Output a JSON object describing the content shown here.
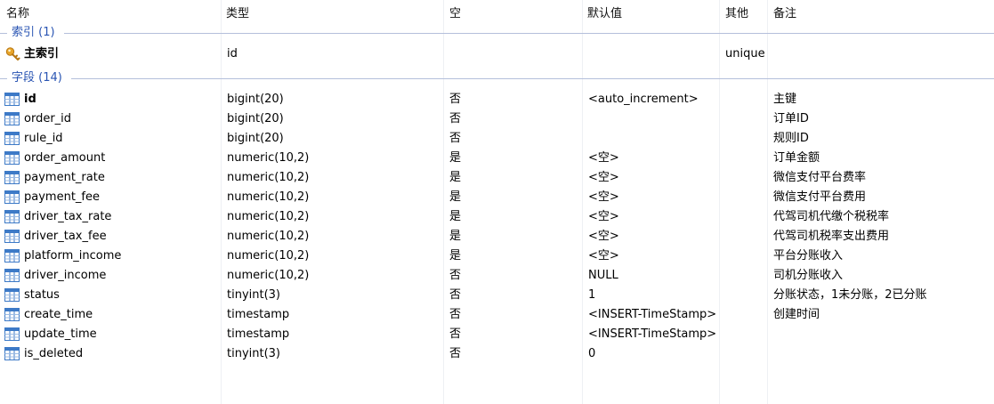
{
  "columns": {
    "name": "名称",
    "type": "类型",
    "nullable": "空",
    "default": "默认值",
    "other": "其他",
    "comment": "备注"
  },
  "indexes_group": {
    "label": "索引 (1)"
  },
  "indexes": [
    {
      "name": "主索引",
      "type": "id",
      "other": "unique",
      "icon": "key-icon"
    }
  ],
  "fields_group": {
    "label": "字段 (14)"
  },
  "fields": [
    {
      "name": "id",
      "type": "bigint(20)",
      "nullable": "否",
      "default": "<auto_increment>",
      "comment": "主键",
      "bold": true
    },
    {
      "name": "order_id",
      "type": "bigint(20)",
      "nullable": "否",
      "default": "",
      "comment": "订单ID"
    },
    {
      "name": "rule_id",
      "type": "bigint(20)",
      "nullable": "否",
      "default": "",
      "comment": "规则ID"
    },
    {
      "name": "order_amount",
      "type": "numeric(10,2)",
      "nullable": "是",
      "default": "<空>",
      "comment": "订单金额"
    },
    {
      "name": "payment_rate",
      "type": "numeric(10,2)",
      "nullable": "是",
      "default": "<空>",
      "comment": "微信支付平台费率"
    },
    {
      "name": "payment_fee",
      "type": "numeric(10,2)",
      "nullable": "是",
      "default": "<空>",
      "comment": "微信支付平台费用"
    },
    {
      "name": "driver_tax_rate",
      "type": "numeric(10,2)",
      "nullable": "是",
      "default": "<空>",
      "comment": "代驾司机代缴个税税率"
    },
    {
      "name": "driver_tax_fee",
      "type": "numeric(10,2)",
      "nullable": "是",
      "default": "<空>",
      "comment": "代驾司机税率支出费用"
    },
    {
      "name": "platform_income",
      "type": "numeric(10,2)",
      "nullable": "是",
      "default": "<空>",
      "comment": "平台分账收入"
    },
    {
      "name": "driver_income",
      "type": "numeric(10,2)",
      "nullable": "否",
      "default": "NULL",
      "comment": "司机分账收入"
    },
    {
      "name": "status",
      "type": "tinyint(3)",
      "nullable": "否",
      "default": "1",
      "comment": "分账状态，1未分账，2已分账"
    },
    {
      "name": "create_time",
      "type": "timestamp",
      "nullable": "否",
      "default": "<INSERT-TimeStamp>",
      "comment": "创建时间"
    },
    {
      "name": "update_time",
      "type": "timestamp",
      "nullable": "否",
      "default": "<INSERT-TimeStamp>",
      "comment": ""
    },
    {
      "name": "is_deleted",
      "type": "tinyint(3)",
      "nullable": "否",
      "default": "0",
      "comment": ""
    }
  ],
  "colors": {
    "group_label": "#2a55b3",
    "group_line": "#b4bfdb",
    "icon_blue": "#3d7ac7",
    "key_gold": "#e8a52a"
  }
}
